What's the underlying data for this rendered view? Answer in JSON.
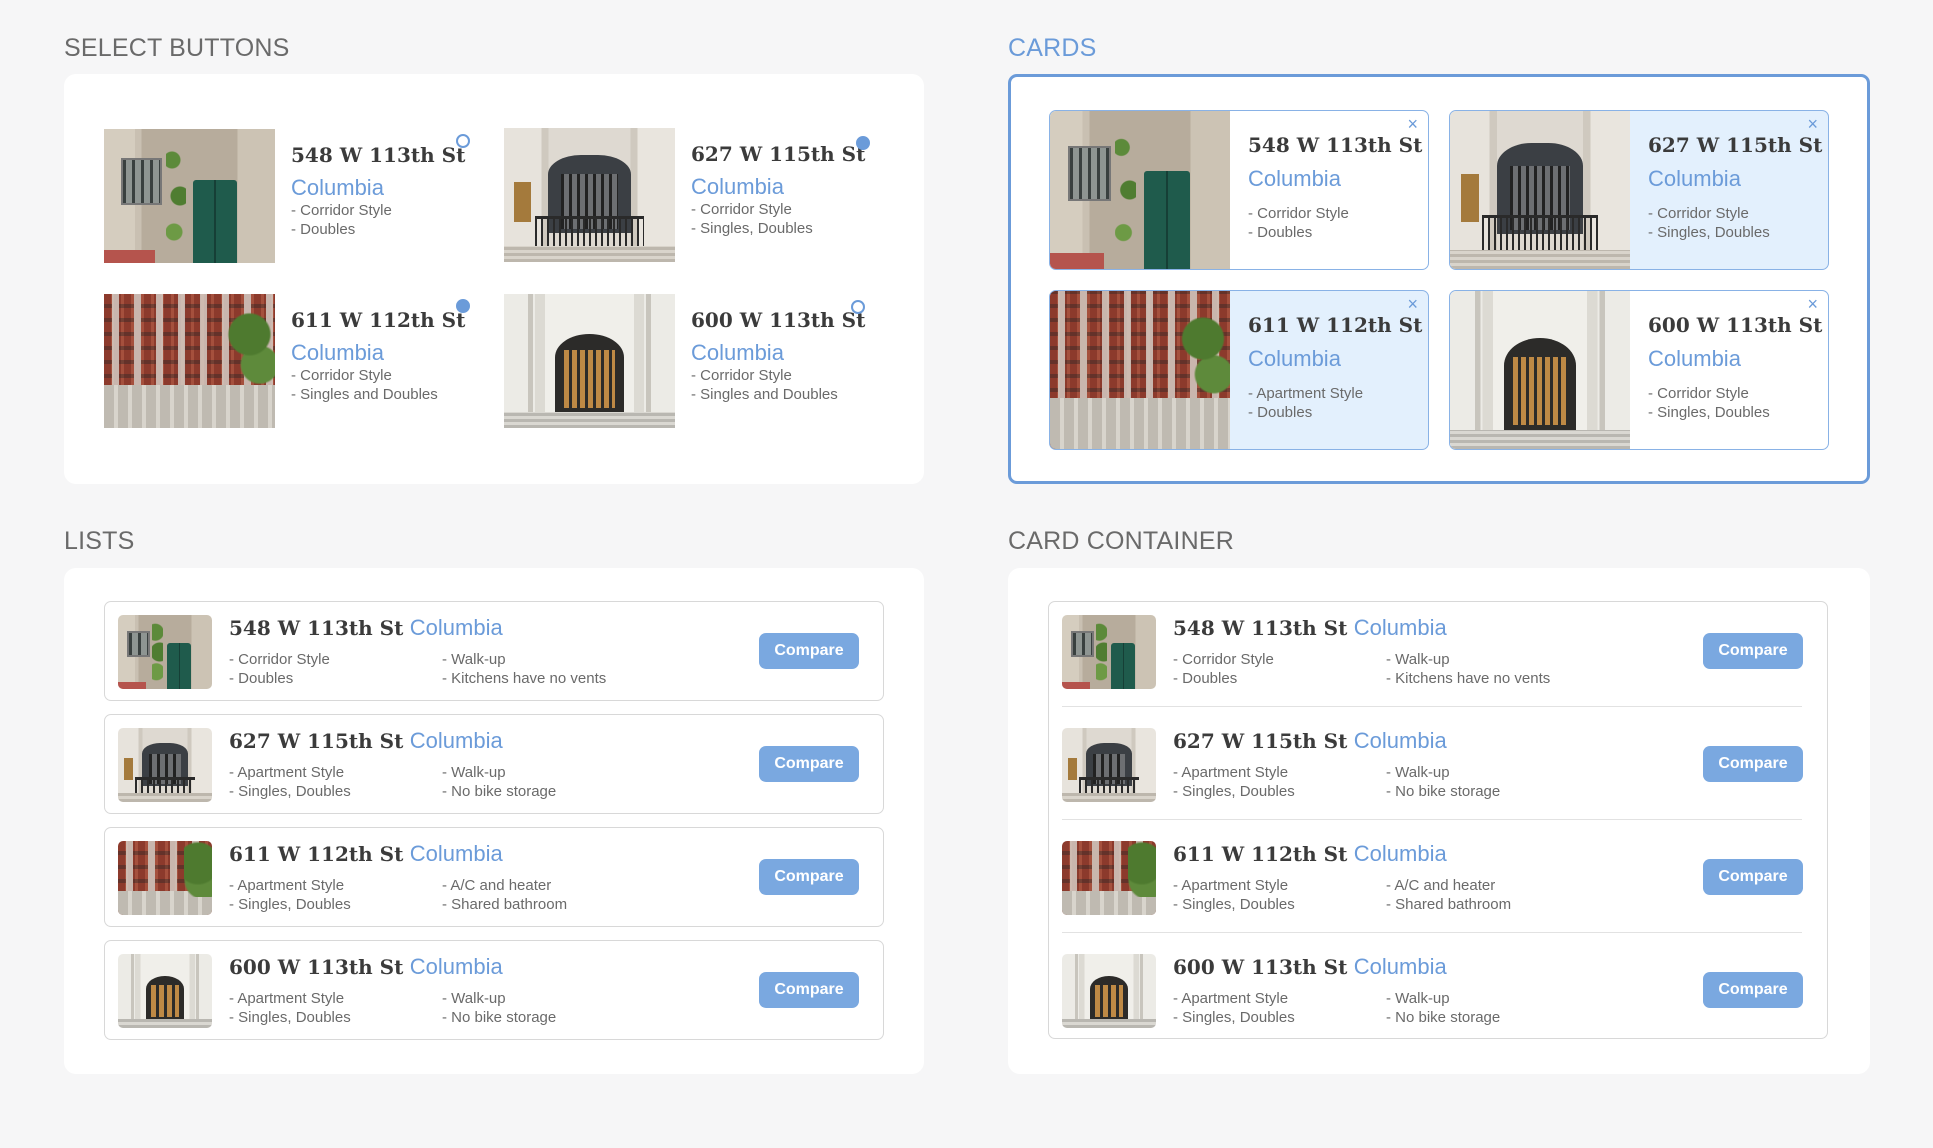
{
  "sections": {
    "select_buttons": "SELECT BUTTONS",
    "cards": "CARDS",
    "lists": "LISTS",
    "card_container": "CARD CONTAINER"
  },
  "listings": [
    {
      "address": "548 W 113th St",
      "area": "Columbia",
      "style": "- Corridor Style",
      "rooms": "- Doubles",
      "note1": "- Walk-up",
      "note2": "- Kitchens have no vents"
    },
    {
      "address": "627 W 115th St",
      "area": "Columbia",
      "style": "- Apartment Style",
      "rooms": "- Singles, Doubles",
      "note1": "- Walk-up",
      "note2": "- No bike storage"
    },
    {
      "address": "611 W 112th St",
      "area": "Columbia",
      "style": "- Apartment Style",
      "rooms": "- Singles, Doubles",
      "note1": "- A/C and heater",
      "note2": "- Shared bathroom"
    },
    {
      "address": "600 W 113th St",
      "area": "Columbia",
      "style": "- Apartment Style",
      "rooms": "- Singles, Doubles",
      "note1": "- Walk-up",
      "note2": "- No bike storage"
    }
  ],
  "select_items": [
    {
      "address": "548 W 113th St",
      "area": "Columbia",
      "style": "- Corridor Style",
      "rooms": "- Doubles",
      "selected": false
    },
    {
      "address": "627 W 115th St",
      "area": "Columbia",
      "style": "- Corridor Style",
      "rooms": "- Singles, Doubles",
      "selected": true
    },
    {
      "address": "611 W 112th St",
      "area": "Columbia",
      "style": "- Corridor Style",
      "rooms": "- Singles and Doubles",
      "selected": true
    },
    {
      "address": "600 W 113th St",
      "area": "Columbia",
      "style": "- Corridor Style",
      "rooms": "- Singles and Doubles",
      "selected": false
    }
  ],
  "card_items": [
    {
      "address": "548 W 113th St",
      "area": "Columbia",
      "style": "- Corridor Style",
      "rooms": "- Doubles",
      "selected": false
    },
    {
      "address": "627 W 115th St",
      "area": "Columbia",
      "style": "- Corridor Style",
      "rooms": "- Singles, Doubles",
      "selected": true
    },
    {
      "address": "611 W 112th St",
      "area": "Columbia",
      "style": "- Apartment Style",
      "rooms": "- Doubles",
      "selected": true
    },
    {
      "address": "600 W 113th St",
      "area": "Columbia",
      "style": "- Corridor Style",
      "rooms": "- Singles, Doubles",
      "selected": false
    }
  ],
  "list_items": [
    {
      "address": "548 W 113th St",
      "area": "Columbia",
      "style": "- Corridor Style",
      "rooms": "- Doubles",
      "note1": "- Walk-up",
      "note2": "- Kitchens have no vents"
    },
    {
      "address": "627 W 115th St",
      "area": "Columbia",
      "style": "- Apartment Style",
      "rooms": "- Singles, Doubles",
      "note1": "- Walk-up",
      "note2": "- No bike storage"
    },
    {
      "address": "611 W 112th St",
      "area": "Columbia",
      "style": "- Apartment Style",
      "rooms": "- Singles, Doubles",
      "note1": "- A/C and heater",
      "note2": "- Shared bathroom"
    },
    {
      "address": "600 W 113th St",
      "area": "Columbia",
      "style": "- Apartment Style",
      "rooms": "- Singles, Doubles",
      "note1": "- Walk-up",
      "note2": "- No bike storage"
    }
  ],
  "close_glyph": "×",
  "compare_label": "Compare",
  "colors": {
    "accent": "#6b9bd9",
    "selected_bg": "#e3f0fd",
    "button": "#7aa8e0"
  }
}
